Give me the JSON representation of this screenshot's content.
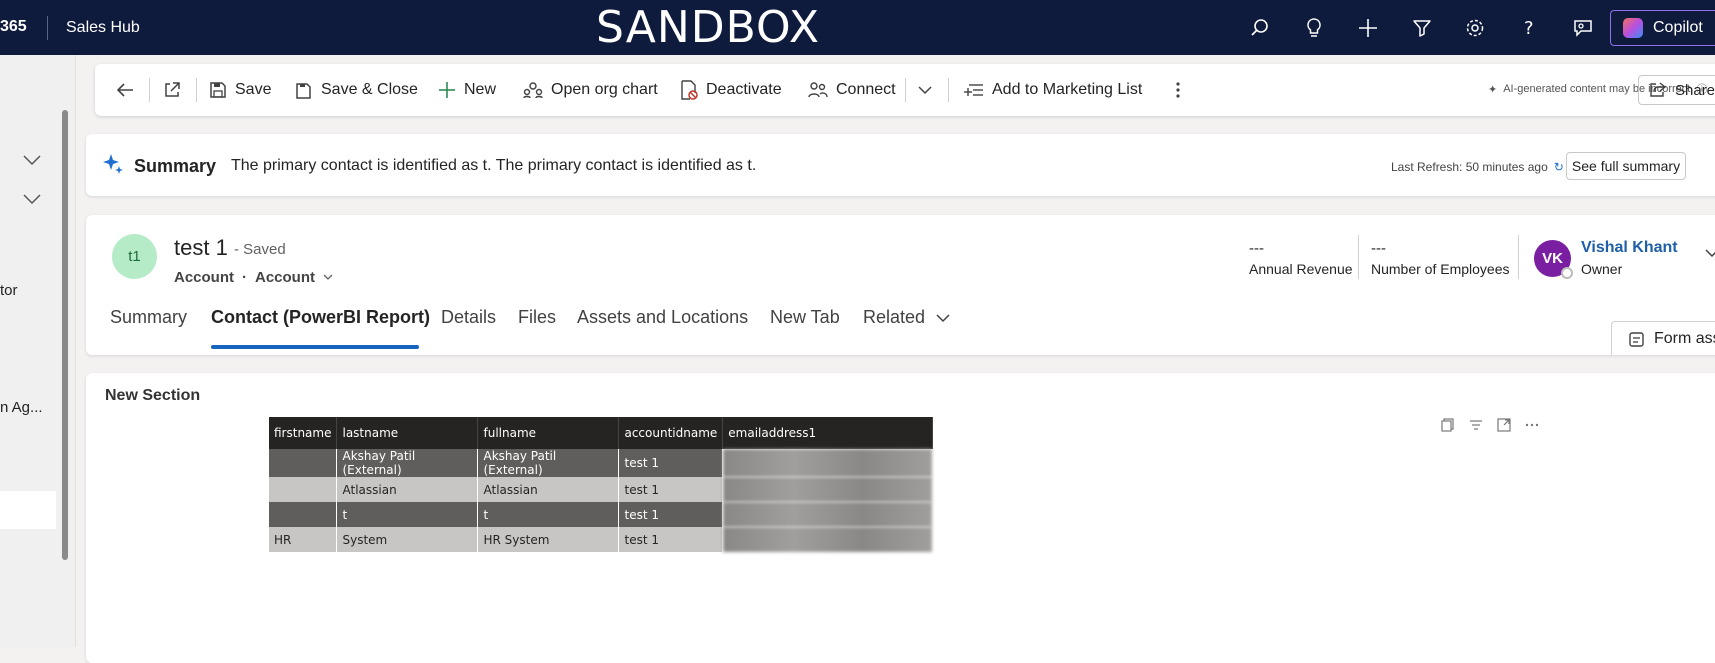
{
  "topbar": {
    "app_name": "365",
    "hub": "Sales Hub",
    "environment": "SANDBOX",
    "copilot": "Copilot"
  },
  "leftnav": {
    "truncated_1": "tor",
    "truncated_2": "n Ag..."
  },
  "commandbar": {
    "save": "Save",
    "save_close": "Save & Close",
    "new": "New",
    "org_chart": "Open org chart",
    "deactivate": "Deactivate",
    "connect": "Connect",
    "marketing_list": "Add to Marketing List",
    "ai_warning": "AI-generated content may be incorrect",
    "share": "Share"
  },
  "summary": {
    "title": "Summary",
    "text": "The primary contact is identified as t. The primary contact is identified as t.",
    "last_refresh": "Last Refresh: 50 minutes ago",
    "see_full": "See full summary"
  },
  "record": {
    "initials": "t1",
    "name": "test 1",
    "status": "- Saved",
    "entity": "Account",
    "form": "Account",
    "annual_revenue_value": "---",
    "annual_revenue_label": "Annual Revenue",
    "employees_value": "---",
    "employees_label": "Number of Employees",
    "owner_initials": "VK",
    "owner_name": "Vishal Khant",
    "owner_label": "Owner"
  },
  "tabs": [
    "Summary",
    "Contact (PowerBI Report)",
    "Details",
    "Files",
    "Assets and Locations",
    "New Tab",
    "Related"
  ],
  "form_assist": "Form ass",
  "section": {
    "title": "New Section",
    "columns": [
      "firstname",
      "lastname",
      "fullname",
      "accountidname",
      "emailaddress1"
    ],
    "rows": [
      {
        "firstname": "",
        "lastname": "Akshay Patil (External)",
        "fullname": "Akshay Patil (External)",
        "accountidname": "test 1",
        "style": "dark"
      },
      {
        "firstname": "",
        "lastname": "Atlassian",
        "fullname": "Atlassian",
        "accountidname": "test 1",
        "style": "light"
      },
      {
        "firstname": "",
        "lastname": "t",
        "fullname": "t",
        "accountidname": "test 1",
        "style": "dark"
      },
      {
        "firstname": "HR",
        "lastname": "System",
        "fullname": "HR System",
        "accountidname": "test 1",
        "style": "light"
      }
    ]
  }
}
